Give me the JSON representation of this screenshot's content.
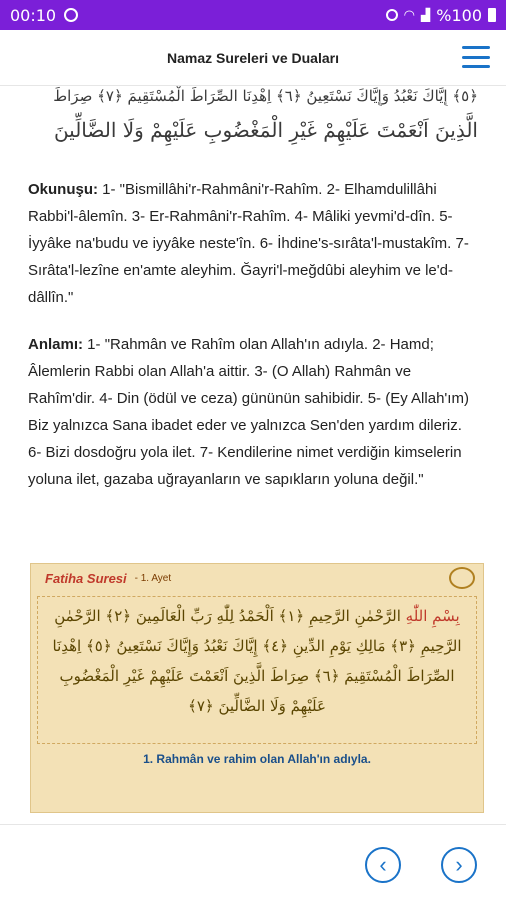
{
  "status_bar": {
    "time": "00:10",
    "battery": "%100"
  },
  "app_bar": {
    "title": "Namaz Sureleri ve Duaları"
  },
  "arabic_text": {
    "line1": "﴿٥﴾ إِيَّاكَ نَعْبُدُ وَإِيَّاكَ نَسْتَعِينُ ﴿٦﴾ اِهْدِنَا الصِّرَاطَ الْمُسْتَقِيمَ ﴿٧﴾ صِرَاطَ",
    "line2": "الَّذِينَ اَنْعَمْتَ عَلَيْهِمْ غَيْرِ الْمَغْضُوبِ عَلَيْهِمْ وَلَا الضَّالِّينَ"
  },
  "okunus": {
    "label": "Okunuşu:",
    "text": " 1- \"Bismillâhi'r-Rahmâni'r-Rahîm. 2- Elhamdulillâhi Rabbi'l-âlemîn. 3- Er-Rahmâni'r-Rahîm. 4- Mâliki yevmi'd-dîn. 5- İyyâke na'budu ve iyyâke neste'în. 6- İhdine's-sırâta'l-mustakîm. 7- Sırâta'l-lezîne en'amte aleyhim. Ğayri'l-meğdûbi aleyhim ve le'd-dâllîn.\""
  },
  "anlami": {
    "label": "Anlamı:",
    "text": " 1- \"Rahmân ve Rahîm olan Allah'ın adıyla. 2- Hamd; Âlemlerin Rabbi olan Allah'a aittir. 3- (O Allah) Rahmân ve Rahîm'dir. 4- Din (ödül ve ceza) gününün sahibidir. 5- (Ey Allah'ım) Biz yalnızca Sana ibadet eder ve yalnızca Sen'den yardım dileriz. 6- Bizi dosdoğru yola ilet. 7- Kendilerine nimet verdiğin kimselerin yoluna ilet, gazaba uğrayanların ve sapıkların yoluna değil.\""
  },
  "card": {
    "title": "Fatiha Suresi",
    "ayet": "- 1. Ayet",
    "arabic_first": "بِسْمِ اللّٰهِ",
    "arabic_rest": " الرَّحْمٰنِ الرَّحِيمِ ﴿١﴾ اَلْحَمْدُ لِلّٰهِ رَبِّ الْعَالَمِينَ ﴿٢﴾ الرَّحْمٰنِ الرَّحِيمِ ﴿٣﴾ مَالِكِ يَوْمِ الدِّينِ ﴿٤﴾ إِيَّاكَ نَعْبُدُ وَإِيَّاكَ نَسْتَعِينُ ﴿٥﴾ اِهْدِنَا الصِّرَاطَ الْمُسْتَقِيمَ ﴿٦﴾ صِرَاطَ الَّذِينَ اَنْعَمْتَ عَلَيْهِمْ غَيْرِ الْمَغْضُوبِ عَلَيْهِمْ وَلَا الضَّالِّينَ ﴿٧﴾",
    "translation": "1. Rahmân ve rahim olan Allah'ın adıyla."
  },
  "nav": {
    "prev_icon": "‹",
    "next_icon": "›"
  }
}
